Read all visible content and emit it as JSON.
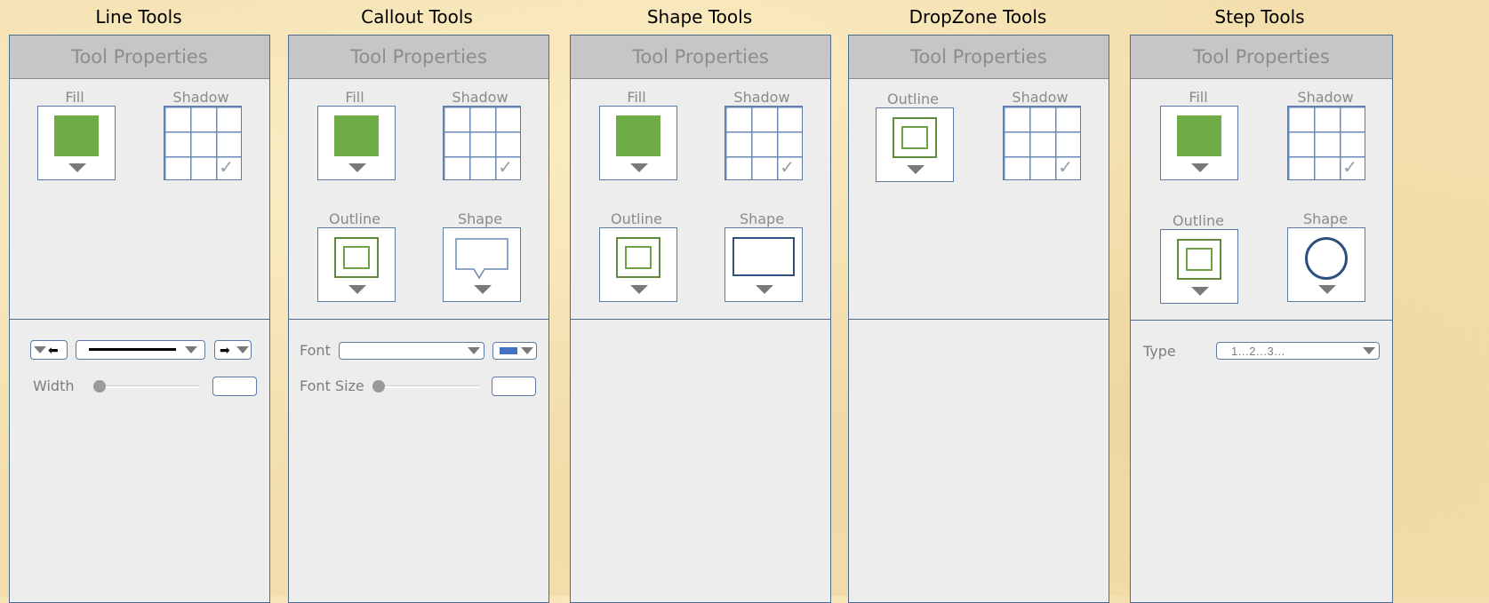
{
  "columns": {
    "line": {
      "title": "Line Tools",
      "header": "Tool Properties",
      "fill_label": "Fill",
      "shadow_label": "Shadow",
      "width_label": "Width"
    },
    "callout": {
      "title": "Callout Tools",
      "header": "Tool Properties",
      "fill_label": "Fill",
      "shadow_label": "Shadow",
      "outline_label": "Outline",
      "shape_label": "Shape",
      "font_label": "Font",
      "font_size_label": "Font Size"
    },
    "shape": {
      "title": "Shape Tools",
      "header": "Tool Properties",
      "fill_label": "Fill",
      "shadow_label": "Shadow",
      "outline_label": "Outline",
      "shape_label": "Shape"
    },
    "dropzone": {
      "title": "DropZone Tools",
      "header": "Tool Properties",
      "outline_label": "Outline",
      "shadow_label": "Shadow"
    },
    "step": {
      "title": "Step Tools",
      "header": "Tool Properties",
      "fill_label": "Fill",
      "shadow_label": "Shadow",
      "outline_label": "Outline",
      "shape_label": "Shape",
      "type_label": "Type",
      "type_value": "1…2…3…"
    }
  },
  "colors": {
    "fill_swatch": "#6fac46",
    "font_color_swatch": "#4472c4",
    "panel_border": "#4f6a8c",
    "background": "#f3dfae"
  },
  "icons": {
    "shadow": "grid-with-check-icon",
    "outline": "nested-square-icon",
    "callout_shape": "speech-bubble-icon",
    "shape_rect": "rectangle-icon",
    "shape_circle": "circle-icon",
    "dropdown": "triangle-down-icon",
    "arrow_left": "arrow-left-icon",
    "arrow_right": "arrow-right-icon"
  }
}
